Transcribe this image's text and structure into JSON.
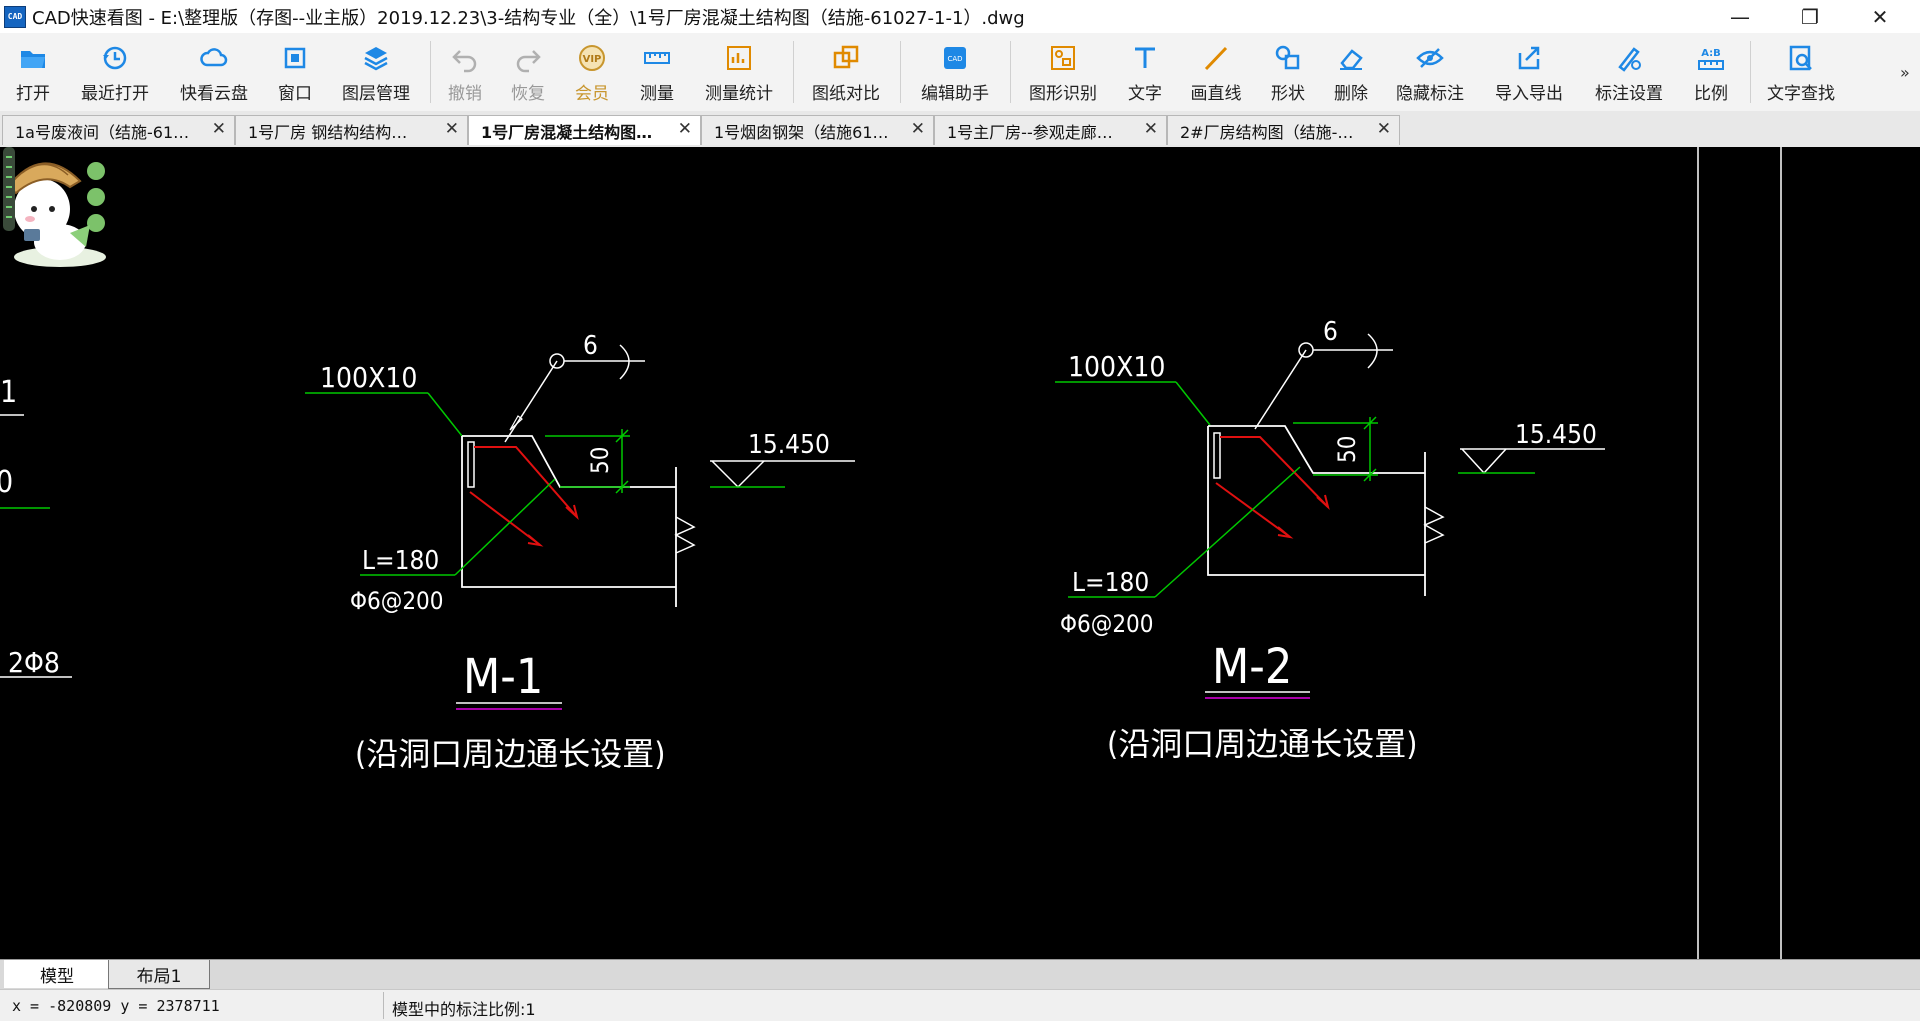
{
  "window": {
    "title": "CAD快速看图 - E:\\整理版（存图--业主版）2019.12.23\\3-结构专业（全）\\1号厂房混凝土结构图（结施-61027-1-1）.dwg",
    "logo_text": "CAD",
    "minimize": "—",
    "maximize": "❐",
    "close": "✕"
  },
  "toolbar": {
    "items": [
      {
        "label": "打开",
        "icon": "folder-open-icon"
      },
      {
        "label": "最近打开",
        "icon": "recent-clock-icon"
      },
      {
        "label": "快看云盘",
        "icon": "cloud-icon"
      },
      {
        "label": "窗口",
        "icon": "window-icon"
      },
      {
        "label": "图层管理",
        "icon": "layers-icon"
      },
      {
        "label": "撤销",
        "icon": "undo-icon"
      },
      {
        "label": "恢复",
        "icon": "redo-icon"
      },
      {
        "label": "会员",
        "icon": "vip-badge-icon",
        "badge": "VIP"
      },
      {
        "label": "测量",
        "icon": "measure-ruler-icon"
      },
      {
        "label": "测量统计",
        "icon": "measure-stats-icon"
      },
      {
        "label": "图纸对比",
        "icon": "compare-icon"
      },
      {
        "label": "编辑助手",
        "icon": "edit-assistant-icon",
        "badge": "CAD"
      },
      {
        "label": "图形识别",
        "icon": "shape-recognize-icon"
      },
      {
        "label": "文字",
        "icon": "text-t-icon"
      },
      {
        "label": "画直线",
        "icon": "line-icon"
      },
      {
        "label": "形状",
        "icon": "shape-icon"
      },
      {
        "label": "删除",
        "icon": "eraser-icon"
      },
      {
        "label": "隐藏标注",
        "icon": "eye-hide-icon"
      },
      {
        "label": "导入导出",
        "icon": "import-export-icon"
      },
      {
        "label": "标注设置",
        "icon": "annotation-settings-icon"
      },
      {
        "label": "比例",
        "icon": "scale-ab-icon",
        "badge": "A:B"
      },
      {
        "label": "文字查找",
        "icon": "text-search-icon"
      }
    ],
    "overflow": "»"
  },
  "tabs": [
    {
      "label": "1a号废液间（结施-61…"
    },
    {
      "label": "1号厂房  钢结构结构…"
    },
    {
      "label": "1号厂房混凝土结构图…",
      "active": true
    },
    {
      "label": "1号烟囱钢架（结施61…"
    },
    {
      "label": "1号主厂房--参观走廊…"
    },
    {
      "label": "2#厂房结构图（结施-…"
    }
  ],
  "tab_close_glyph": "✕",
  "drawing": {
    "left_fragments": {
      "a": "1",
      "b": "0",
      "c": "2Φ8"
    },
    "details": [
      {
        "name": "M-1",
        "plate": "100X10",
        "weld": "6",
        "dim": "50",
        "elev": "15.450",
        "anchor_len": "L=180",
        "stirrup": "Φ6@200",
        "note": "(沿洞口周边通长设置)"
      },
      {
        "name": "M-2",
        "plate": "100X10",
        "weld": "6",
        "dim": "50",
        "elev": "15.450",
        "anchor_len": "L=180",
        "stirrup": "Φ6@200",
        "note": "(沿洞口周边通长设置)"
      }
    ],
    "colors": {
      "white": "#ffffff",
      "green": "#00c800",
      "red": "#e01010",
      "magenta": "#e000e0",
      "background": "#000000"
    }
  },
  "layout_tabs": [
    {
      "label": "模型",
      "active": true
    },
    {
      "label": "布局1"
    }
  ],
  "status": {
    "coords": "x = -820809  y = 2378711",
    "scale": "模型中的标注比例:1"
  }
}
